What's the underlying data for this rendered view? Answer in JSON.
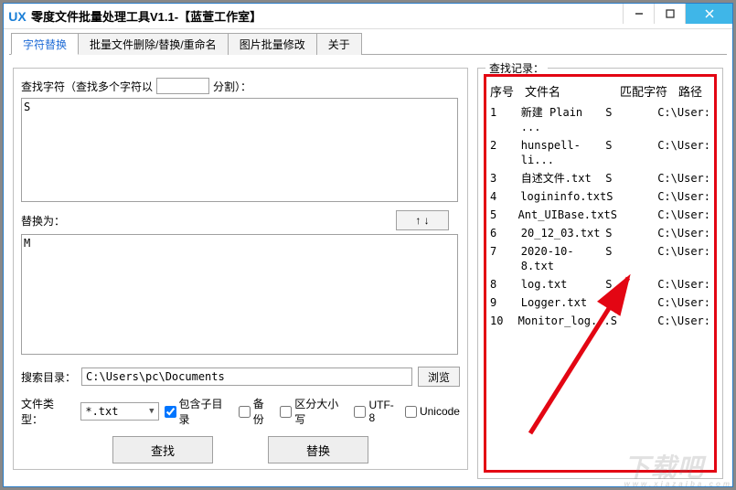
{
  "window": {
    "title": "零度文件批量处理工具V1.1-【蓝萱工作室】",
    "icon_text": "UX"
  },
  "tabs": [
    {
      "label": "字符替换",
      "active": true
    },
    {
      "label": "批量文件删除/替换/重命名",
      "active": false
    },
    {
      "label": "图片批量修改",
      "active": false
    },
    {
      "label": "关于",
      "active": false
    }
  ],
  "panel": {
    "find_label_prefix": "查找字符（查找多个字符以",
    "find_label_suffix": "分割）：",
    "split_value": "",
    "find_value": "S",
    "swap_btn": "↑ ↓",
    "replace_label": "替换为：",
    "replace_value": "M",
    "dir_label": "搜索目录：",
    "dir_value": "C:\\Users\\pc\\Documents",
    "browse_btn": "浏览",
    "type_label": "文件类型：",
    "type_value": "*.txt",
    "checkboxes": {
      "subdir": {
        "label": "包含子目录",
        "checked": true
      },
      "backup": {
        "label": "备份",
        "checked": false
      },
      "casesens": {
        "label": "区分大小写",
        "checked": false
      },
      "utf8": {
        "label": "UTF-8",
        "checked": false
      },
      "unicode": {
        "label": "Unicode",
        "checked": false
      }
    },
    "find_btn": "查找",
    "replace_btn": "替换"
  },
  "results": {
    "title": "查找记录：",
    "headers": {
      "no": "序号",
      "fn": "文件名",
      "match": "匹配字符",
      "path": "路径"
    },
    "rows": [
      {
        "no": "1",
        "fn": "新建 Plain ...",
        "match": "S",
        "path": "C:\\User:"
      },
      {
        "no": "2",
        "fn": "hunspell-li...",
        "match": "S",
        "path": "C:\\User:"
      },
      {
        "no": "3",
        "fn": "自述文件.txt",
        "match": "S",
        "path": "C:\\User:"
      },
      {
        "no": "4",
        "fn": "logininfo.txt",
        "match": "S",
        "path": "C:\\User:"
      },
      {
        "no": "5",
        "fn": "Ant_UIBase.txt",
        "match": "S",
        "path": "C:\\User:"
      },
      {
        "no": "6",
        "fn": "20_12_03.txt",
        "match": "S",
        "path": "C:\\User:"
      },
      {
        "no": "7",
        "fn": "2020-10-8.txt",
        "match": "S",
        "path": "C:\\User:"
      },
      {
        "no": "8",
        "fn": "log.txt",
        "match": "S",
        "path": "C:\\User:"
      },
      {
        "no": "9",
        "fn": "Logger.txt",
        "match": "S",
        "path": "C:\\User:"
      },
      {
        "no": "10",
        "fn": "Monitor_log...",
        "match": "S",
        "path": "C:\\User:"
      }
    ]
  },
  "watermark": {
    "main": "下载吧",
    "sub": "www.xiazaiba.com"
  }
}
